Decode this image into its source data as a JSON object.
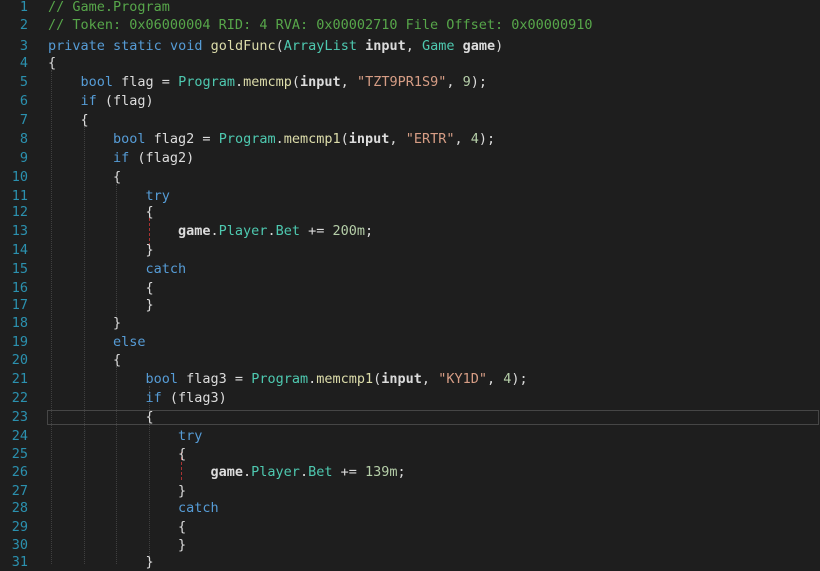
{
  "editor": {
    "current_line": 23,
    "lines": [
      {
        "n": "1",
        "indent": 0,
        "tokens": [
          [
            "comment",
            "// Game.Program"
          ]
        ]
      },
      {
        "n": "2",
        "indent": 0,
        "tokens": [
          [
            "comment",
            "// Token: 0x06000004 RID: 4 RVA: 0x00002710 File Offset: 0x00000910"
          ]
        ]
      },
      {
        "n": "3",
        "indent": 0,
        "tokens": [
          [
            "kw",
            "private"
          ],
          [
            "punct",
            " "
          ],
          [
            "kw",
            "static"
          ],
          [
            "punct",
            " "
          ],
          [
            "kw",
            "void"
          ],
          [
            "punct",
            " "
          ],
          [
            "func",
            "goldFunc"
          ],
          [
            "punct",
            "("
          ],
          [
            "type",
            "ArrayList"
          ],
          [
            "punct",
            " "
          ],
          [
            "param",
            "input"
          ],
          [
            "punct",
            ", "
          ],
          [
            "type",
            "Game"
          ],
          [
            "punct",
            " "
          ],
          [
            "param",
            "game"
          ],
          [
            "punct",
            ")"
          ]
        ]
      },
      {
        "n": "4",
        "indent": 0,
        "tokens": [
          [
            "punct",
            "{"
          ]
        ]
      },
      {
        "n": "5",
        "indent": 1,
        "tokens": [
          [
            "kw",
            "bool"
          ],
          [
            "punct",
            " "
          ],
          [
            "id",
            "flag"
          ],
          [
            "punct",
            " = "
          ],
          [
            "type",
            "Program"
          ],
          [
            "punct",
            "."
          ],
          [
            "func",
            "memcmp"
          ],
          [
            "punct",
            "("
          ],
          [
            "param",
            "input"
          ],
          [
            "punct",
            ", "
          ],
          [
            "str",
            "\"TZT9PR1S9\""
          ],
          [
            "punct",
            ", "
          ],
          [
            "num",
            "9"
          ],
          [
            "punct",
            ");"
          ]
        ]
      },
      {
        "n": "6",
        "indent": 1,
        "tokens": [
          [
            "kw",
            "if"
          ],
          [
            "punct",
            " ("
          ],
          [
            "id",
            "flag"
          ],
          [
            "punct",
            ")"
          ]
        ]
      },
      {
        "n": "7",
        "indent": 1,
        "tokens": [
          [
            "punct",
            "{"
          ]
        ]
      },
      {
        "n": "8",
        "indent": 2,
        "tokens": [
          [
            "kw",
            "bool"
          ],
          [
            "punct",
            " "
          ],
          [
            "id",
            "flag2"
          ],
          [
            "punct",
            " = "
          ],
          [
            "type",
            "Program"
          ],
          [
            "punct",
            "."
          ],
          [
            "func",
            "memcmp1"
          ],
          [
            "punct",
            "("
          ],
          [
            "param",
            "input"
          ],
          [
            "punct",
            ", "
          ],
          [
            "str",
            "\"ERTR\""
          ],
          [
            "punct",
            ", "
          ],
          [
            "num",
            "4"
          ],
          [
            "punct",
            ");"
          ]
        ]
      },
      {
        "n": "9",
        "indent": 2,
        "tokens": [
          [
            "kw",
            "if"
          ],
          [
            "punct",
            " ("
          ],
          [
            "id",
            "flag2"
          ],
          [
            "punct",
            ")"
          ]
        ]
      },
      {
        "n": "10",
        "indent": 2,
        "tokens": [
          [
            "punct",
            "{"
          ]
        ]
      },
      {
        "n": "11",
        "indent": 3,
        "tokens": [
          [
            "kw",
            "try"
          ]
        ]
      },
      {
        "n": "12",
        "indent": 3,
        "tokens": [
          [
            "punct",
            "{"
          ]
        ]
      },
      {
        "n": "13",
        "indent": 4,
        "tokens": [
          [
            "param",
            "game"
          ],
          [
            "punct",
            "."
          ],
          [
            "field",
            "Player"
          ],
          [
            "punct",
            "."
          ],
          [
            "field",
            "Bet"
          ],
          [
            "punct",
            " += "
          ],
          [
            "num",
            "200m"
          ],
          [
            "punct",
            ";"
          ]
        ]
      },
      {
        "n": "14",
        "indent": 3,
        "tokens": [
          [
            "punct",
            "}"
          ]
        ]
      },
      {
        "n": "15",
        "indent": 3,
        "tokens": [
          [
            "kw",
            "catch"
          ]
        ]
      },
      {
        "n": "16",
        "indent": 3,
        "tokens": [
          [
            "punct",
            "{"
          ]
        ]
      },
      {
        "n": "17",
        "indent": 3,
        "tokens": [
          [
            "punct",
            "}"
          ]
        ]
      },
      {
        "n": "18",
        "indent": 2,
        "tokens": [
          [
            "punct",
            "}"
          ]
        ]
      },
      {
        "n": "19",
        "indent": 2,
        "tokens": [
          [
            "kw",
            "else"
          ]
        ]
      },
      {
        "n": "20",
        "indent": 2,
        "tokens": [
          [
            "punct",
            "{"
          ]
        ]
      },
      {
        "n": "21",
        "indent": 3,
        "tokens": [
          [
            "kw",
            "bool"
          ],
          [
            "punct",
            " "
          ],
          [
            "id",
            "flag3"
          ],
          [
            "punct",
            " = "
          ],
          [
            "type",
            "Program"
          ],
          [
            "punct",
            "."
          ],
          [
            "func",
            "memcmp1"
          ],
          [
            "punct",
            "("
          ],
          [
            "param",
            "input"
          ],
          [
            "punct",
            ", "
          ],
          [
            "str",
            "\"KY1D\""
          ],
          [
            "punct",
            ", "
          ],
          [
            "num",
            "4"
          ],
          [
            "punct",
            ");"
          ]
        ]
      },
      {
        "n": "22",
        "indent": 3,
        "tokens": [
          [
            "kw",
            "if"
          ],
          [
            "punct",
            " ("
          ],
          [
            "id",
            "flag3"
          ],
          [
            "punct",
            ")"
          ]
        ]
      },
      {
        "n": "23",
        "indent": 3,
        "tokens": [
          [
            "punct",
            "{"
          ]
        ]
      },
      {
        "n": "24",
        "indent": 4,
        "tokens": [
          [
            "kw",
            "try"
          ]
        ]
      },
      {
        "n": "25",
        "indent": 4,
        "tokens": [
          [
            "punct",
            "{"
          ]
        ]
      },
      {
        "n": "26",
        "indent": 5,
        "tokens": [
          [
            "param",
            "game"
          ],
          [
            "punct",
            "."
          ],
          [
            "field",
            "Player"
          ],
          [
            "punct",
            "."
          ],
          [
            "field",
            "Bet"
          ],
          [
            "punct",
            " += "
          ],
          [
            "num",
            "139m"
          ],
          [
            "punct",
            ";"
          ]
        ]
      },
      {
        "n": "27",
        "indent": 4,
        "tokens": [
          [
            "punct",
            "}"
          ]
        ]
      },
      {
        "n": "28",
        "indent": 4,
        "tokens": [
          [
            "kw",
            "catch"
          ]
        ]
      },
      {
        "n": "29",
        "indent": 4,
        "tokens": [
          [
            "punct",
            "{"
          ]
        ]
      },
      {
        "n": "30",
        "indent": 4,
        "tokens": [
          [
            "punct",
            "}"
          ]
        ]
      },
      {
        "n": "31",
        "indent": 3,
        "tokens": [
          [
            "punct",
            "}"
          ]
        ]
      }
    ]
  }
}
